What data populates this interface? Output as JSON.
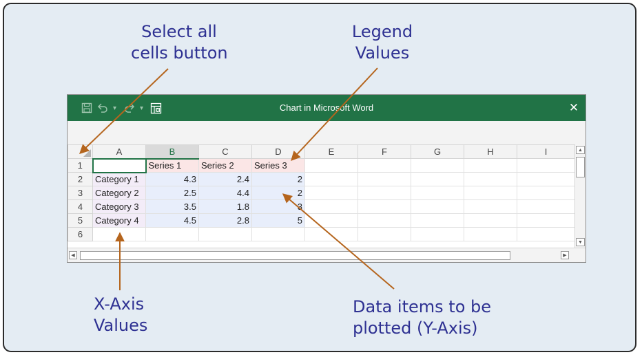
{
  "callouts": {
    "select_all": [
      "Select all",
      "cells button"
    ],
    "legend": [
      "Legend",
      "Values"
    ],
    "x_axis": [
      "X-Axis",
      "Values"
    ],
    "data_items": [
      "Data items to be",
      "plotted (Y-Axis)"
    ]
  },
  "window": {
    "title": "Chart in Microsoft Word",
    "close_glyph": "✕",
    "qat_icons": [
      "save-icon",
      "undo-icon",
      "redo-icon",
      "edit-data-icon"
    ]
  },
  "sheet": {
    "columns": [
      "A",
      "B",
      "C",
      "D",
      "E",
      "F",
      "G",
      "H",
      "I"
    ],
    "rows": [
      [
        "1",
        "",
        "Series 1",
        "Series 2",
        "Series 3",
        "",
        "",
        "",
        "",
        ""
      ],
      [
        "2",
        "Category 1",
        "4.3",
        "2.4",
        "2",
        "",
        "",
        "",
        "",
        ""
      ],
      [
        "3",
        "Category 2",
        "2.5",
        "4.4",
        "2",
        "",
        "",
        "",
        "",
        ""
      ],
      [
        "4",
        "Category 3",
        "3.5",
        "1.8",
        "3",
        "",
        "",
        "",
        "",
        ""
      ],
      [
        "5",
        "Category 4",
        "4.5",
        "2.8",
        "5",
        "",
        "",
        "",
        "",
        ""
      ],
      [
        "6",
        "",
        "",
        "",
        "",
        "",
        "",
        "",
        "",
        ""
      ]
    ]
  },
  "colors": {
    "excel_green": "#217346",
    "callout_text": "#2e3192",
    "arrow": "#b5651d",
    "panel_bg": "#e4ecf3"
  }
}
